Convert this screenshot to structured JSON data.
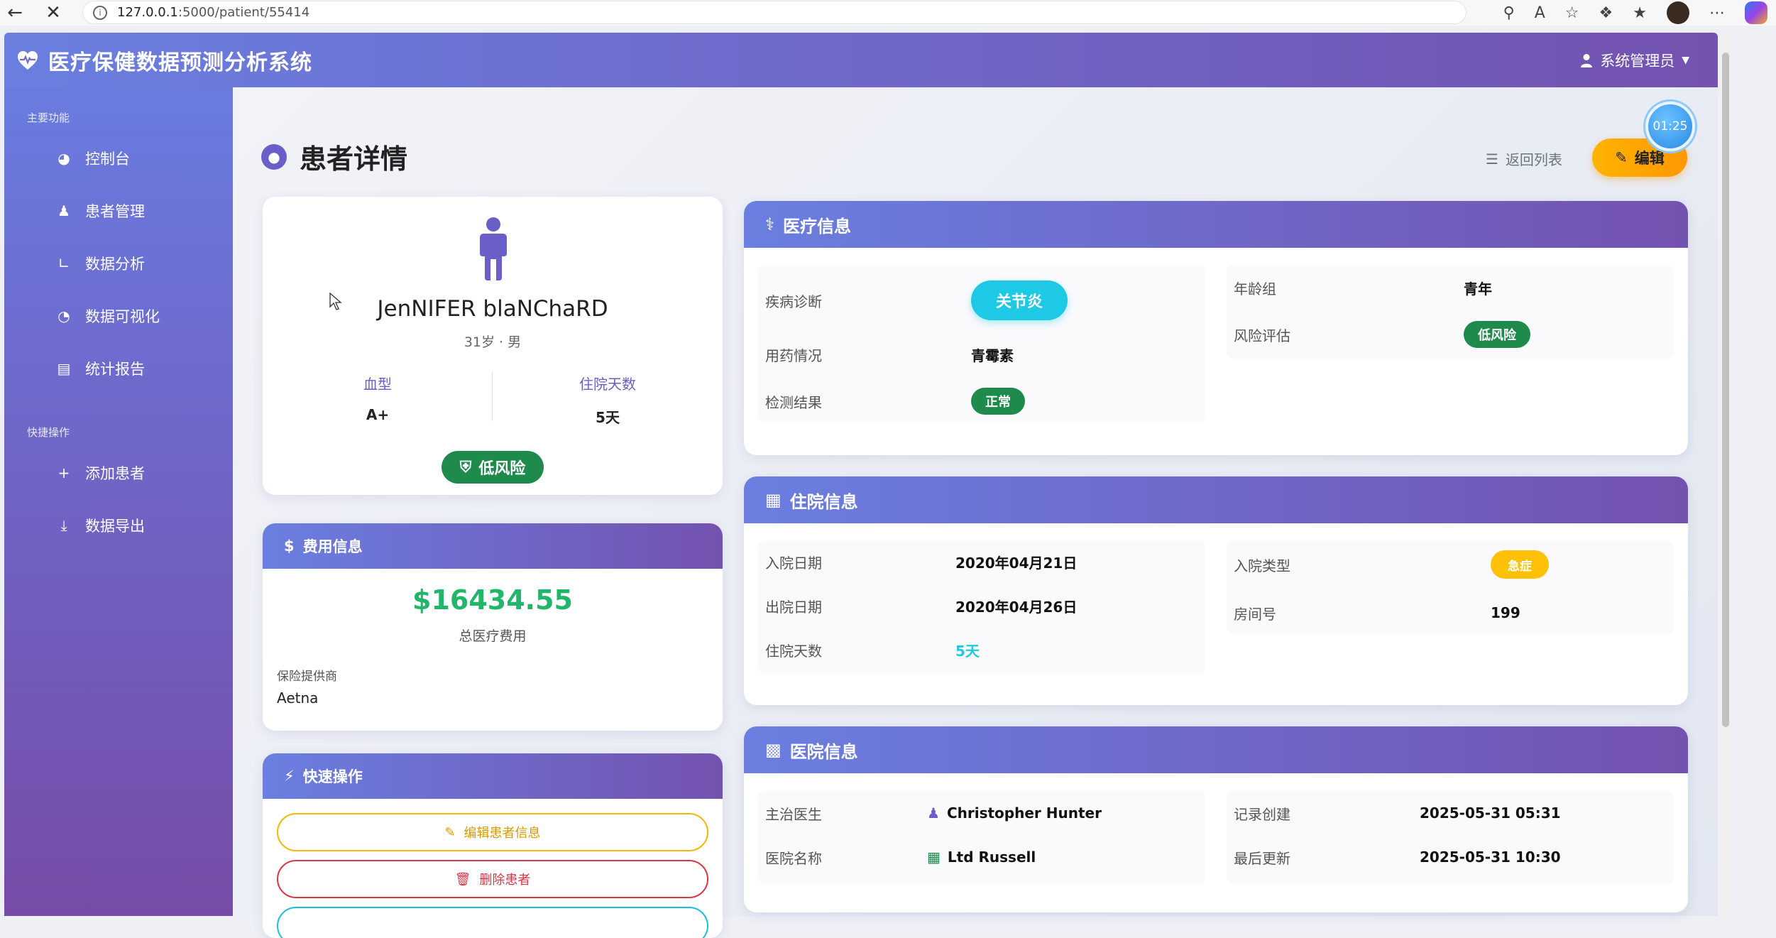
{
  "browser": {
    "url_host": "127.0.0.1",
    "url_path": ":5000/patient/55414"
  },
  "app": {
    "title": "医疗保健数据预测分析系统",
    "user": "系统管理员",
    "timer": "01:25"
  },
  "sidebar": {
    "section_main": "主要功能",
    "items": [
      {
        "label": "控制台",
        "icon": "gauge-icon"
      },
      {
        "label": "患者管理",
        "icon": "users-icon"
      },
      {
        "label": "数据分析",
        "icon": "chart-bar-icon"
      },
      {
        "label": "数据可视化",
        "icon": "pie-chart-icon"
      },
      {
        "label": "统计报告",
        "icon": "document-icon"
      }
    ],
    "section_quick": "快捷操作",
    "quick_items": [
      {
        "label": "添加患者",
        "icon": "plus-icon"
      },
      {
        "label": "数据导出",
        "icon": "download-icon"
      }
    ]
  },
  "page": {
    "title": "患者详情",
    "back_label": "返回列表",
    "edit_label": "编辑"
  },
  "profile": {
    "name": "JenNIFER blaNChaRD",
    "sub": "31岁 · 男",
    "blood_label": "血型",
    "blood_value": "A+",
    "stay_label": "住院天数",
    "stay_value": "5天",
    "risk": "低风险"
  },
  "fee": {
    "title": "费用信息",
    "amount": "$16434.55",
    "amount_label": "总医疗费用",
    "insurer_label": "保险提供商",
    "insurer_value": "Aetna"
  },
  "quick_actions": {
    "title": "快速操作",
    "edit": "编辑患者信息",
    "delete": "删除患者"
  },
  "medical": {
    "title": "医疗信息",
    "diagnosis_label": "疾病诊断",
    "diagnosis_value": "关节炎",
    "medication_label": "用药情况",
    "medication_value": "青霉素",
    "test_label": "检测结果",
    "test_value": "正常",
    "age_group_label": "年龄组",
    "age_group_value": "青年",
    "risk_label": "风险评估",
    "risk_value": "低风险"
  },
  "hospitalization": {
    "title": "住院信息",
    "admit_label": "入院日期",
    "admit_value": "2020年04月21日",
    "discharge_label": "出院日期",
    "discharge_value": "2020年04月26日",
    "days_label": "住院天数",
    "days_value": "5天",
    "type_label": "入院类型",
    "type_value": "急症",
    "room_label": "房间号",
    "room_value": "199"
  },
  "hospital": {
    "title": "医院信息",
    "doctor_label": "主治医生",
    "doctor_value": "Christopher Hunter",
    "hospital_label": "医院名称",
    "hospital_value": "Ltd Russell",
    "created_label": "记录创建",
    "created_value": "2025-05-31 05:31",
    "updated_label": "最后更新",
    "updated_value": "2025-05-31 10:30"
  },
  "colors": {
    "header_start": "#6a7fe0",
    "header_end": "#7452b0",
    "success": "#1e8a4c",
    "amount": "#22b66a",
    "cyan": "#1ec9e6",
    "warning": "#ffc107"
  }
}
